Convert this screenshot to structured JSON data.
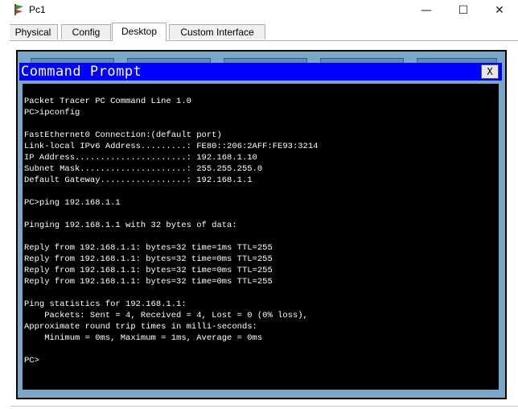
{
  "window": {
    "title": "Pc1",
    "minimize_glyph": "—",
    "maximize_glyph": "☐",
    "close_glyph": "✕"
  },
  "tabs": [
    {
      "label": "Physical"
    },
    {
      "label": "Config"
    },
    {
      "label": "Desktop"
    },
    {
      "label": "Custom Interface"
    }
  ],
  "active_tab": "Desktop",
  "command_prompt": {
    "title": "Command Prompt",
    "close_label": "X",
    "output": "Packet Tracer PC Command Line 1.0\nPC>ipconfig\n\nFastEthernet0 Connection:(default port)\nLink-local IPv6 Address.........: FE80::206:2AFF:FE93:3214\nIP Address......................: 192.168.1.10\nSubnet Mask.....................: 255.255.255.0\nDefault Gateway.................: 192.168.1.1\n\nPC>ping 192.168.1.1\n\nPinging 192.168.1.1 with 32 bytes of data:\n\nReply from 192.168.1.1: bytes=32 time=1ms TTL=255\nReply from 192.168.1.1: bytes=32 time=0ms TTL=255\nReply from 192.168.1.1: bytes=32 time=0ms TTL=255\nReply from 192.168.1.1: bytes=32 time=0ms TTL=255\n\nPing statistics for 192.168.1.1:\n    Packets: Sent = 4, Received = 4, Lost = 0 (0% loss),\nApproximate round trip times in milli-seconds:\n    Minimum = 0ms, Maximum = 1ms, Average = 0ms\n\nPC>"
  },
  "colors": {
    "cmd_titlebar": "#0000ff",
    "desktop_background": "#7aa7c8",
    "terminal_background": "#000000",
    "terminal_text": "#ffffff"
  }
}
